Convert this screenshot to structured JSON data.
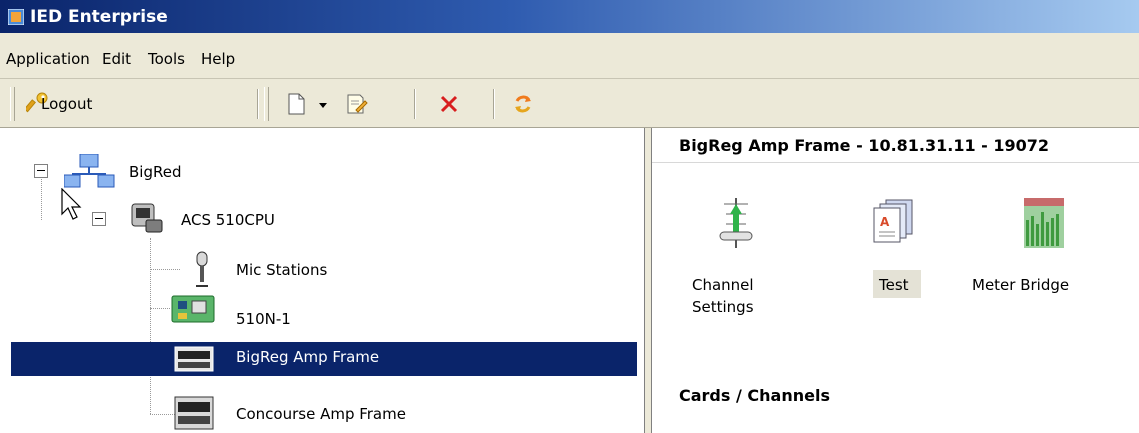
{
  "window": {
    "title": "IED Enterprise"
  },
  "menu": [
    "Application",
    "Edit",
    "Tools",
    "Help"
  ],
  "toolbar": {
    "logout_label": "Logout"
  },
  "tree": {
    "root": "BigRed",
    "child": "ACS 510CPU",
    "items": [
      "Mic Stations",
      "510N-1",
      "BigReg Amp Frame",
      "Concourse Amp Frame"
    ],
    "selected_index": 2
  },
  "detail": {
    "title": "BigReg Amp Frame - 10.81.31.11 - 19072",
    "actions": [
      {
        "label_line1": "Channel",
        "label_line2": "Settings"
      },
      {
        "label_line1": "Test",
        "label_line2": ""
      },
      {
        "label_line1": "Meter Bridge",
        "label_line2": ""
      }
    ],
    "section": "Cards / Channels"
  },
  "colors": {
    "titlebar": "#0a246a",
    "selection": "#0a246a",
    "window_bg": "#ece9d8"
  }
}
